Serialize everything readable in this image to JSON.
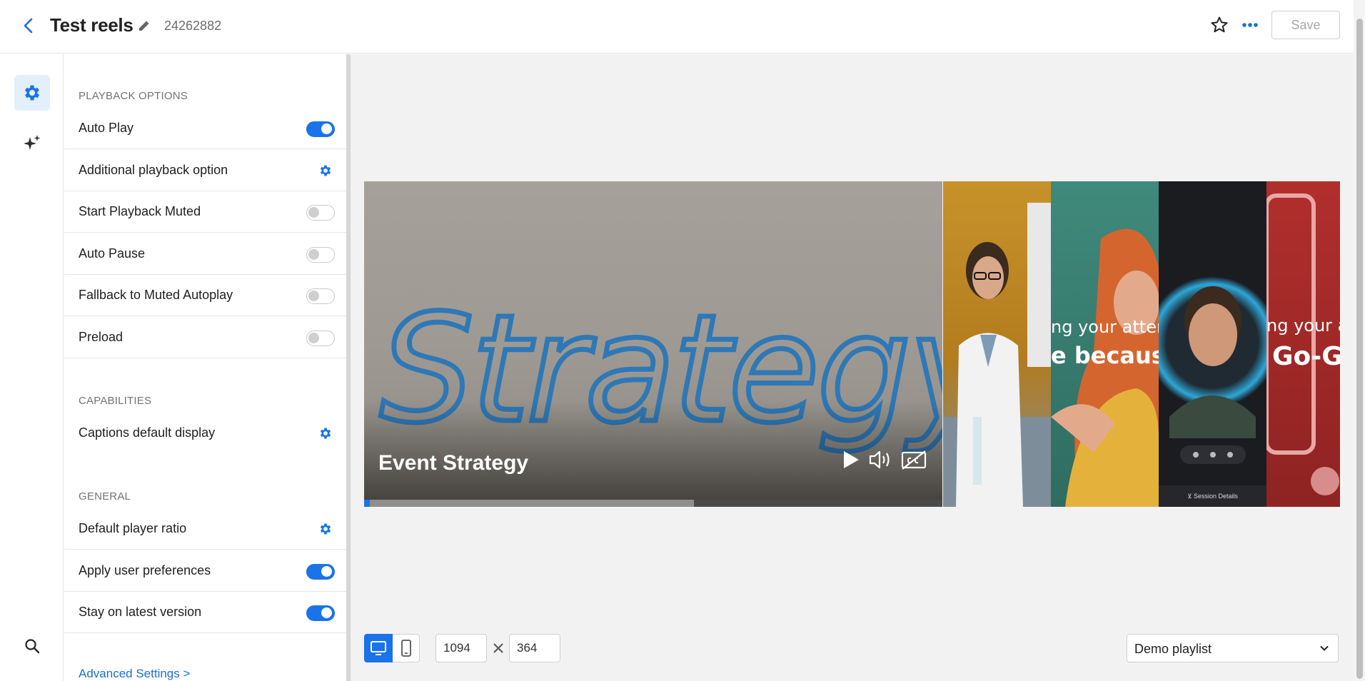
{
  "header": {
    "title": "Test reels",
    "entry_id": "24262882",
    "save_label": "Save"
  },
  "rail": {
    "items": [
      {
        "icon": "gear-icon",
        "active": true
      },
      {
        "icon": "sparkles-icon",
        "active": false
      },
      {
        "icon": "search-icon",
        "active": false
      }
    ]
  },
  "panel": {
    "sections": {
      "playback": "PLAYBACK OPTIONS",
      "capabilities": "CAPABILITIES",
      "general": "GENERAL"
    },
    "playback_options": [
      {
        "label": "Auto Play",
        "control": "toggle",
        "on": true
      },
      {
        "label": "Additional playback option",
        "control": "gear"
      },
      {
        "label": "Start Playback Muted",
        "control": "toggle",
        "on": false
      },
      {
        "label": "Auto Pause",
        "control": "toggle",
        "on": false
      },
      {
        "label": "Fallback to Muted Autoplay",
        "control": "toggle",
        "on": false
      },
      {
        "label": "Preload",
        "control": "toggle",
        "on": false
      }
    ],
    "capabilities_options": [
      {
        "label": "Captions default display",
        "control": "gear"
      }
    ],
    "general_options": [
      {
        "label": "Default player ratio",
        "control": "gear"
      },
      {
        "label": "Apply user preferences",
        "control": "toggle",
        "on": true
      },
      {
        "label": "Stay on latest version",
        "control": "toggle",
        "on": true
      }
    ],
    "advanced_link": "Advanced Settings >"
  },
  "preview": {
    "main_reel_title": "Event Strategy",
    "whiteboard_text": "Strategy",
    "progress": 0.57,
    "progress_played": 0.01,
    "thumbnails": [
      {
        "name": "scientist"
      },
      {
        "name": "woman-talking",
        "text_top": "ng your atter",
        "text_bottom": "e because"
      },
      {
        "name": "speaker-portrait",
        "footer": "⊻ Session Details"
      },
      {
        "name": "red-card",
        "text_top": "ng your a",
        "text_bottom": "Go-G"
      }
    ]
  },
  "footer": {
    "width_value": "1094",
    "height_value": "364",
    "playlist_selected": "Demo playlist"
  },
  "colors": {
    "accent": "#1a73e8",
    "panel_bg": "#ffffff",
    "preview_bg": "#f2f2f2"
  }
}
